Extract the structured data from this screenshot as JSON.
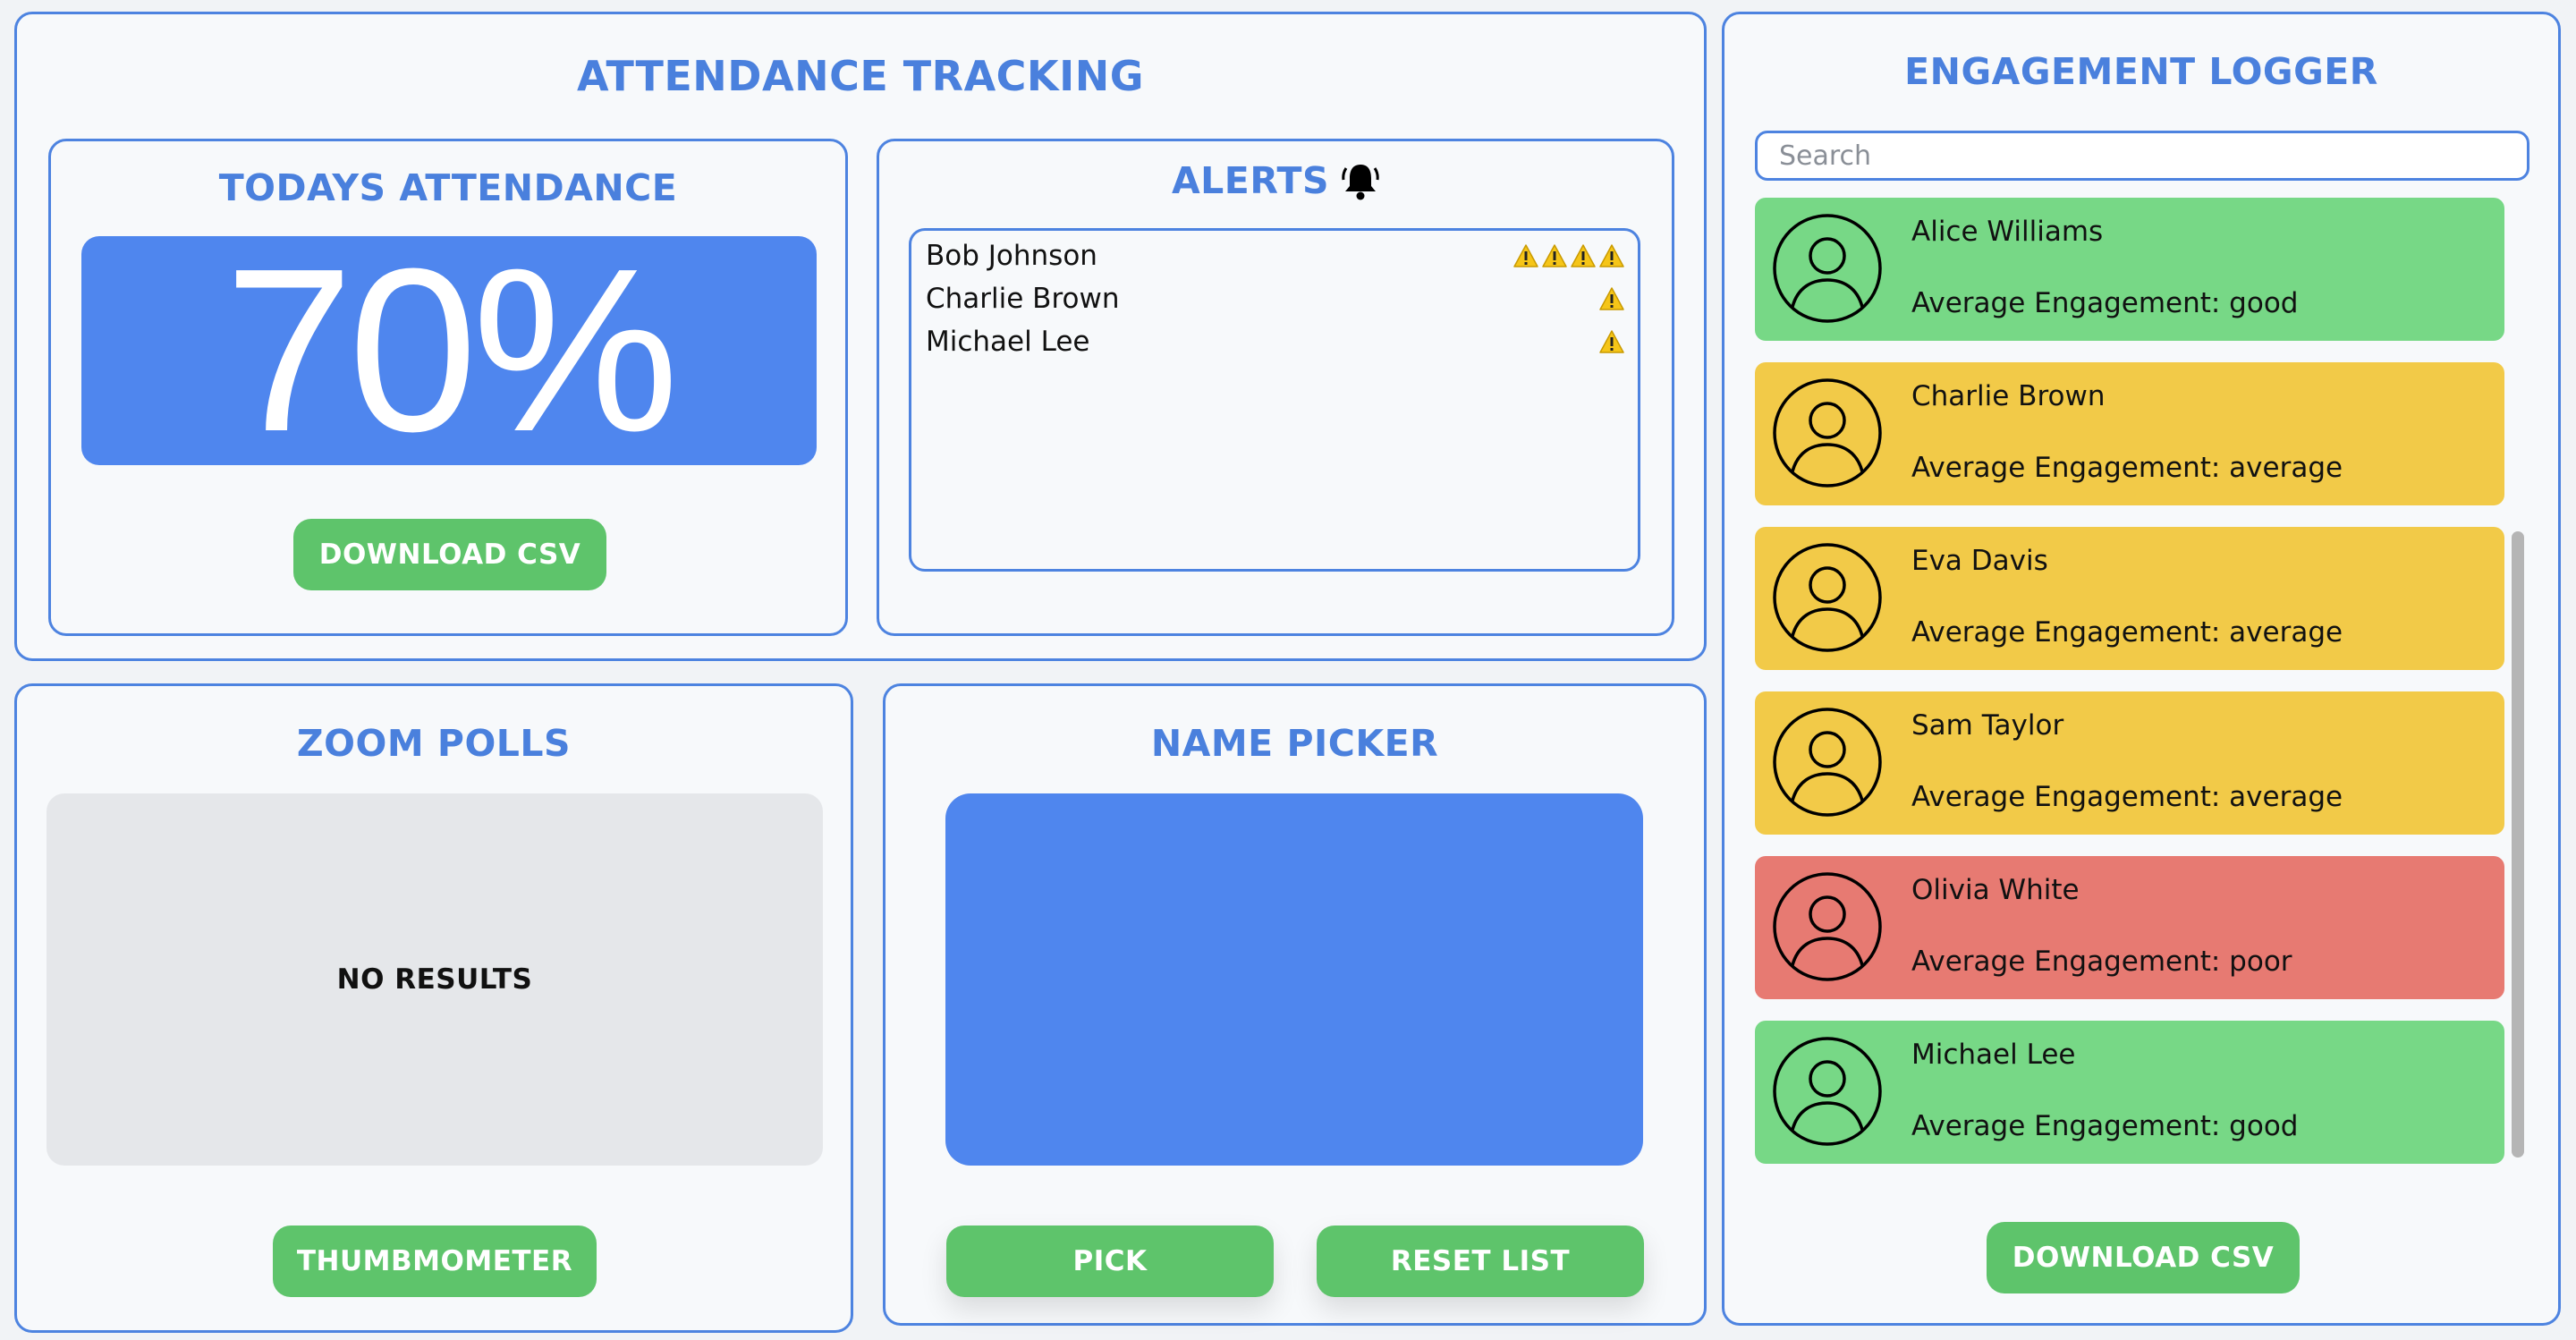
{
  "attendance": {
    "title": "ATTENDANCE TRACKING",
    "todays": {
      "title": "TODAYS ATTENDANCE",
      "percent": "70%",
      "download_label": "DOWNLOAD CSV"
    },
    "alerts": {
      "title": "ALERTS",
      "icon": "bell-icon",
      "items": [
        {
          "name": "Bob Johnson",
          "warnings": 4
        },
        {
          "name": "Charlie Brown",
          "warnings": 1
        },
        {
          "name": "Michael Lee",
          "warnings": 1
        }
      ]
    }
  },
  "polls": {
    "title": "ZOOM POLLS",
    "empty_text": "NO RESULTS",
    "button_label": "THUMBMOMETER"
  },
  "picker": {
    "title": "NAME PICKER",
    "pick_label": "PICK",
    "reset_label": "RESET LIST"
  },
  "engagement": {
    "title": "ENGAGEMENT LOGGER",
    "search_placeholder": "Search",
    "students": [
      {
        "name": "Alice Williams",
        "engagement": "Average Engagement: good",
        "level": "good"
      },
      {
        "name": "Charlie Brown",
        "engagement": "Average Engagement: average",
        "level": "average"
      },
      {
        "name": "Eva Davis",
        "engagement": "Average Engagement: average",
        "level": "average"
      },
      {
        "name": "Sam Taylor",
        "engagement": "Average Engagement: average",
        "level": "average"
      },
      {
        "name": "Olivia White",
        "engagement": "Average Engagement: poor",
        "level": "poor"
      },
      {
        "name": "Michael Lee",
        "engagement": "Average Engagement: good",
        "level": "good"
      }
    ],
    "download_label": "DOWNLOAD CSV"
  },
  "colors": {
    "accent": "#4a80dd",
    "good": "#77d886",
    "average": "#f2ca48",
    "poor": "#e77a72",
    "button": "#5ec46b",
    "warning": "#f5c518"
  }
}
